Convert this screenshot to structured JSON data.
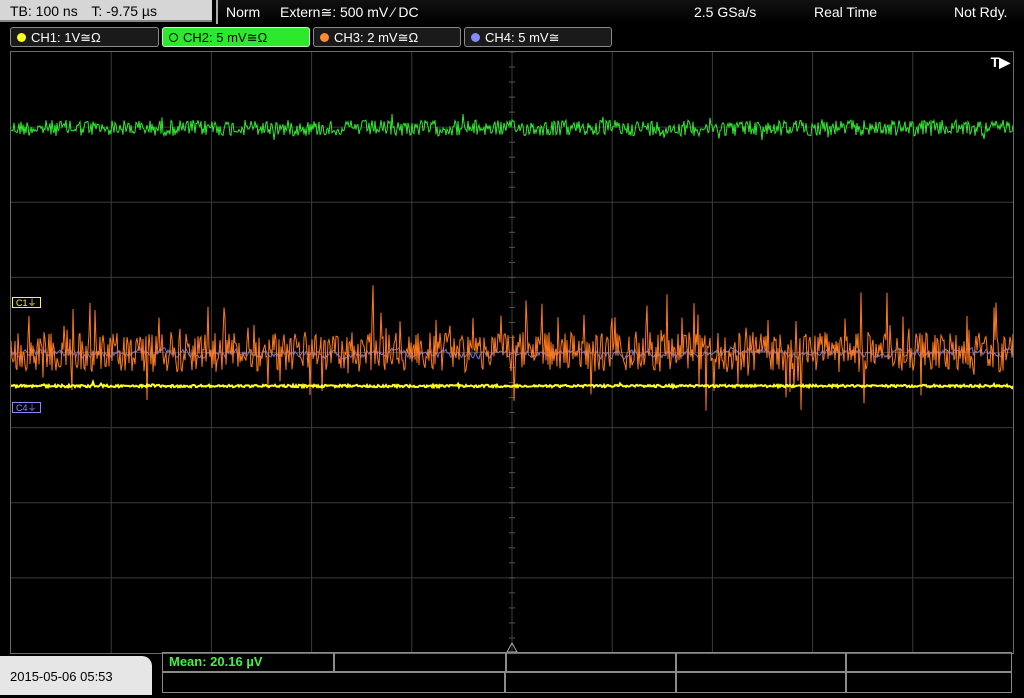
{
  "topbar": {
    "timebase": "TB: 100 ns",
    "trigger_time": "T: -9.75 µs",
    "mode": "Norm",
    "trigger_source": "Extern≅: 500 mV ⁄ DC",
    "sample_rate": "2.5 GSa/s",
    "acq_mode": "Real Time",
    "status": "Not Rdy."
  },
  "channels": [
    {
      "label": "CH1: 1V≅Ω",
      "color": "#ffff20",
      "active": false
    },
    {
      "label": "CH2: 5 mV≅Ω",
      "color": "#2ee82e",
      "active": true
    },
    {
      "label": "CH3: 2 mV≅Ω",
      "color": "#ff8a30",
      "active": false
    },
    {
      "label": "CH4: 5 mV≅",
      "color": "#8888ff",
      "active": false
    }
  ],
  "markers": {
    "ch1": "C1⏚",
    "ch4": "C4⏚",
    "trigger": "T▶"
  },
  "colors": {
    "ch1": "#ffff20",
    "ch2": "#2ee82e",
    "ch3": "#ff7a1a",
    "ch4": "#7070e0",
    "grid": "#3a3a3a"
  },
  "datetime": "2015-05-06 05:53",
  "measurement": {
    "label": "Mean: 20.16 µV"
  }
}
